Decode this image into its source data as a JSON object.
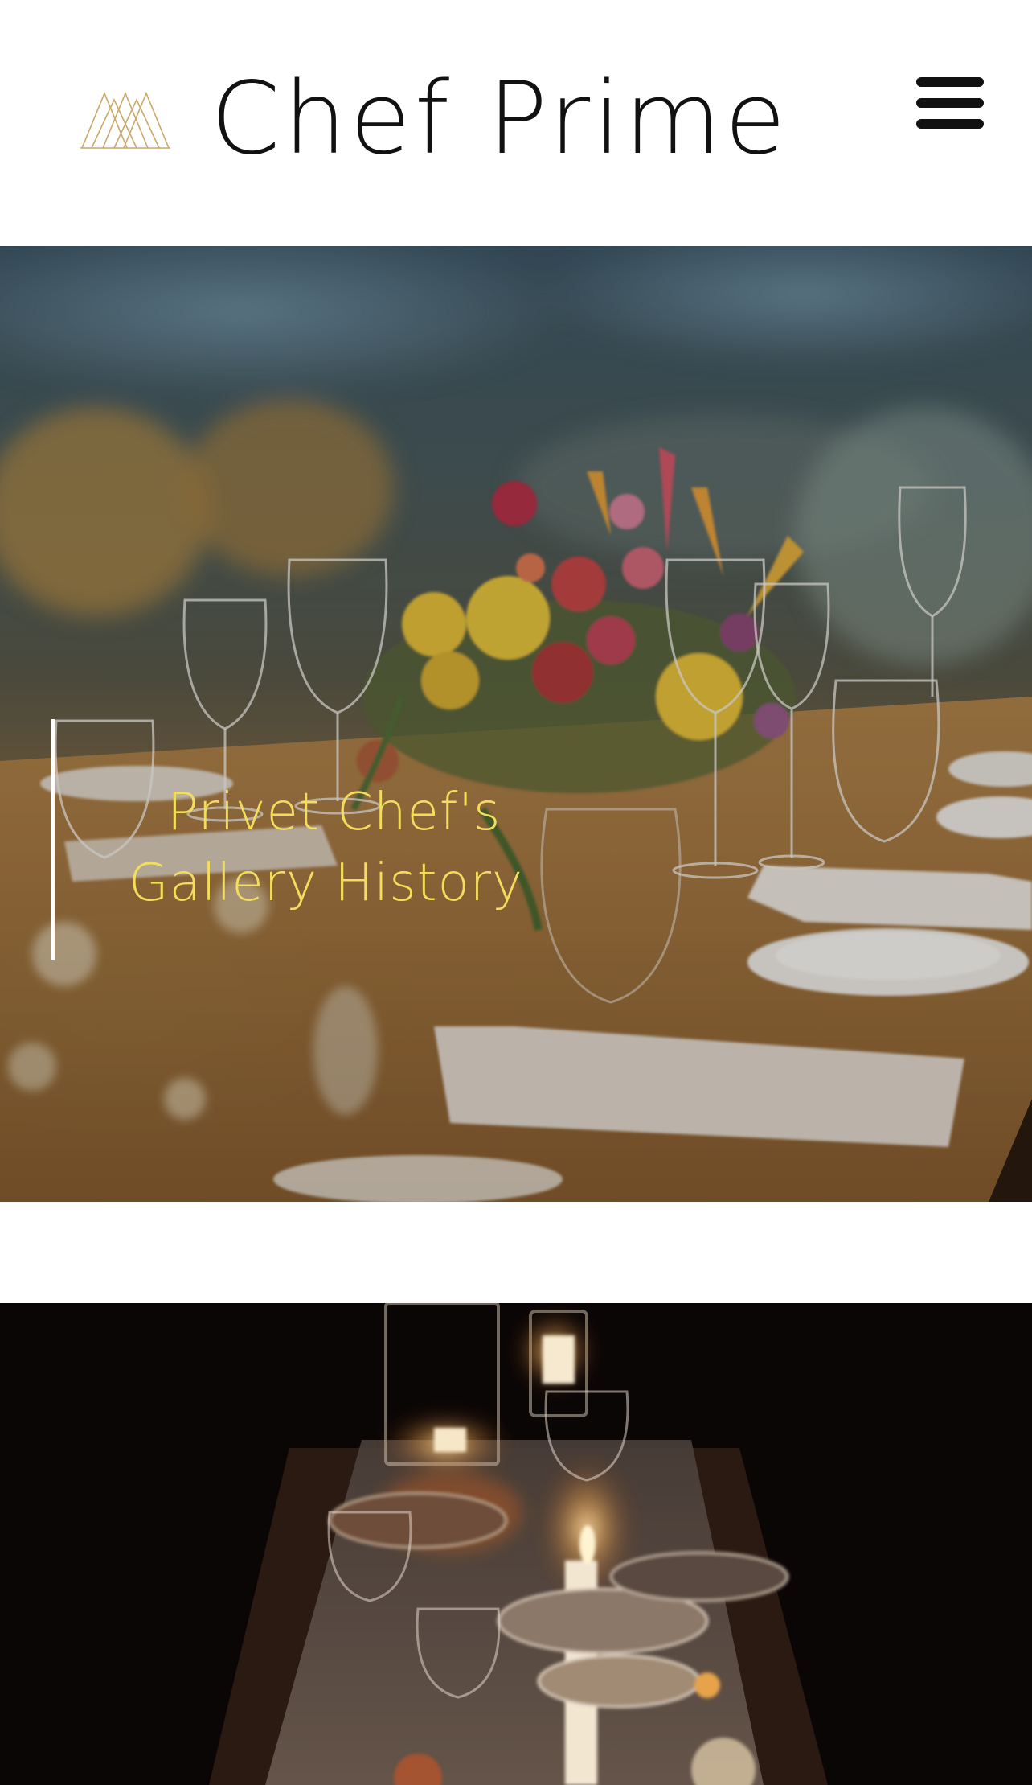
{
  "header": {
    "brand_name": "Chef Prime",
    "logo_icon": "triangle-mountain-logo-icon",
    "menu_icon": "hamburger-menu-icon"
  },
  "hero": {
    "title_line1": "Privet Chef's",
    "title_line2": "Gallery History",
    "image": "long dining table with floral centerpiece and wine glasses",
    "accent_color": "#f2de5c"
  },
  "gallery": {
    "image": "candlelit dinner table at night"
  },
  "colors": {
    "logo_gold": "#c9a86a",
    "text_dark": "#111111",
    "hero_title": "#f2de5c"
  }
}
